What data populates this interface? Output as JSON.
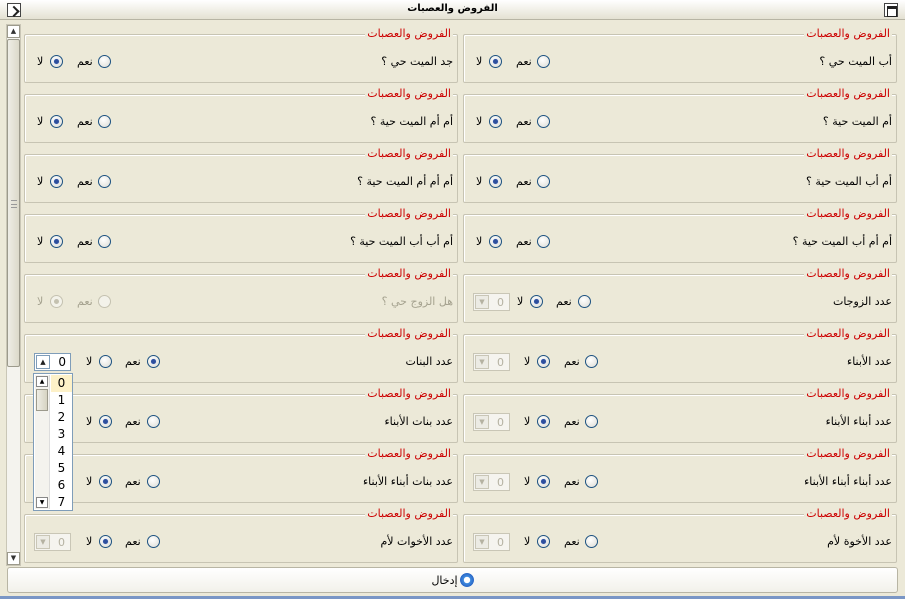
{
  "window": {
    "title": "الفروض والعصبات"
  },
  "labels": {
    "yes": "نعم",
    "no": "لا"
  },
  "groups": [
    {
      "id": "father",
      "legend": "الفروض والعصبات",
      "question": "أب الميت حي ؟",
      "answer": "no",
      "disabled": false
    },
    {
      "id": "grandfather",
      "legend": "الفروض والعصبات",
      "question": "جد الميت حي ؟",
      "answer": "no",
      "disabled": false
    },
    {
      "id": "mother",
      "legend": "الفروض والعصبات",
      "question": "أم الميت حية ؟",
      "answer": "no",
      "disabled": false
    },
    {
      "id": "mothers-mother",
      "legend": "الفروض والعصبات",
      "question": "أم أم الميت حية ؟",
      "answer": "no",
      "disabled": false
    },
    {
      "id": "fathers-mother",
      "legend": "الفروض والعصبات",
      "question": "أم أب الميت حية ؟",
      "answer": "no",
      "disabled": false
    },
    {
      "id": "mothers-mothers-mother",
      "legend": "الفروض والعصبات",
      "question": "أم أم أم الميت حية ؟",
      "answer": "no",
      "disabled": false
    },
    {
      "id": "mothers-fathers-mother",
      "legend": "الفروض والعصبات",
      "question": "أم أم أب الميت حية ؟",
      "answer": "no",
      "disabled": false
    },
    {
      "id": "fathers-fathers-mother",
      "legend": "الفروض والعصبات",
      "question": "أم أب أب الميت حية ؟",
      "answer": "no",
      "disabled": false
    },
    {
      "id": "wives-count",
      "legend": "الفروض والعصبات",
      "question": "عدد الزوجات",
      "answer": "no",
      "count": "0",
      "disabled": false
    },
    {
      "id": "husband",
      "legend": "الفروض والعصبات",
      "question": "هل الزوج حي ؟",
      "answer": "no",
      "disabled": true
    },
    {
      "id": "sons-count",
      "legend": "الفروض والعصبات",
      "question": "عدد الأبناء",
      "answer": "no",
      "count": "0",
      "disabled": false
    },
    {
      "id": "daughters-count",
      "legend": "الفروض والعصبات",
      "question": "عدد البنات",
      "answer": "yes",
      "count": "0",
      "disabled": false
    },
    {
      "id": "sons-sons-count",
      "legend": "الفروض والعصبات",
      "question": "عدد أبناء الأبناء",
      "answer": "no",
      "count": "0",
      "disabled": false
    },
    {
      "id": "sons-daughters-count",
      "legend": "الفروض والعصبات",
      "question": "عدد بنات الأبناء",
      "answer": "no",
      "disabled": false
    },
    {
      "id": "sons-sons-sons-count",
      "legend": "الفروض والعصبات",
      "question": "عدد أبناء أبناء الأبناء",
      "answer": "no",
      "count": "0",
      "disabled": false
    },
    {
      "id": "sons-sons-daughters-count",
      "legend": "الفروض والعصبات",
      "question": "عدد بنات أبناء الأبناء",
      "answer": "no",
      "disabled": false
    },
    {
      "id": "maternal-brothers-count",
      "legend": "الفروض والعصبات",
      "question": "عدد الأخوة لأم",
      "answer": "no",
      "count": "0",
      "disabled": false
    },
    {
      "id": "maternal-sisters-count",
      "legend": "الفروض والعصبات",
      "question": "عدد الأخوات لأم",
      "answer": "no",
      "count": "0",
      "disabled": false
    }
  ],
  "dropdown": {
    "options": [
      "0",
      "1",
      "2",
      "3",
      "4",
      "5",
      "6",
      "7"
    ],
    "selected": "0"
  },
  "footer": {
    "enter_label": "إدخال"
  },
  "icons": {
    "window_menu": "arrow-icon",
    "window_maximize": "maximize-icon",
    "enter": "refresh-icon"
  },
  "colors": {
    "legend": "#cc0000",
    "background": "#ece9d8",
    "radio_dot": "#2e4f9e"
  }
}
